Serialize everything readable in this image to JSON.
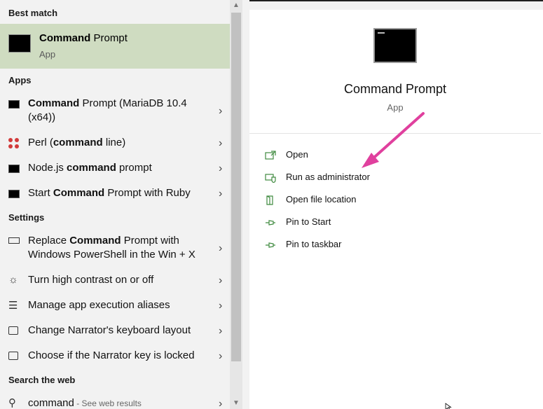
{
  "left": {
    "best_match_header": "Best match",
    "best_match": {
      "title_bold": "Command",
      "title_rest": " Prompt",
      "subtitle": "App"
    },
    "apps_header": "Apps",
    "apps": [
      {
        "bold": "Command",
        "rest": " Prompt (MariaDB 10.4",
        "line2": "(x64))"
      },
      {
        "pre": "Perl (",
        "bold": "command",
        "rest": " line)"
      },
      {
        "pre": "Node.js ",
        "bold": "command",
        "rest": " prompt"
      },
      {
        "pre": "Start ",
        "bold": "Command",
        "rest": " Prompt with Ruby"
      }
    ],
    "settings_header": "Settings",
    "settings": [
      {
        "pre": "Replace ",
        "bold": "Command",
        "rest": " Prompt with",
        "line2": "Windows PowerShell in the Win + X"
      },
      {
        "text": "Turn high contrast on or off"
      },
      {
        "text": "Manage app execution aliases"
      },
      {
        "text": "Change Narrator's keyboard layout"
      },
      {
        "text": "Choose if the Narrator key is locked"
      }
    ],
    "web_header": "Search the web",
    "web": {
      "query": "command",
      "suffix": " - See web results"
    }
  },
  "right": {
    "title": "Command Prompt",
    "subtitle": "App",
    "actions": [
      {
        "label": "Open",
        "icon": "open-icon"
      },
      {
        "label": "Run as administrator",
        "icon": "shield-icon"
      },
      {
        "label": "Open file location",
        "icon": "folder-icon"
      },
      {
        "label": "Pin to Start",
        "icon": "pin-icon"
      },
      {
        "label": "Pin to taskbar",
        "icon": "pin-icon"
      }
    ]
  },
  "colors": {
    "accent_green": "#3f8a3f",
    "highlight": "#cfdcc1",
    "arrow": "#e0409e"
  }
}
